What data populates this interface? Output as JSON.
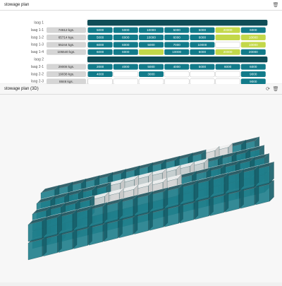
{
  "panel_top": {
    "title": "stowage plan",
    "icon": "trash-icon"
  },
  "panel_bottom": {
    "title": "stowage plan (3D)",
    "icons": [
      "refresh-icon",
      "trash-icon"
    ]
  },
  "chart_data": {
    "type": "table",
    "title": "",
    "x_ticks": [
      "0",
      "5",
      "10"
    ],
    "rows": [
      {
        "label": "laag 1",
        "weight": "",
        "header": true,
        "cells": []
      },
      {
        "label": "laag 1-1",
        "weight": "74612 kgs.",
        "cells": [
          {
            "v": "5000",
            "c": "t"
          },
          {
            "v": "5000",
            "c": "t"
          },
          {
            "v": "10000",
            "c": "t"
          },
          {
            "v": "5000",
            "c": "t"
          },
          {
            "v": "5000",
            "c": "t"
          },
          {
            "v": "20000",
            "c": "y"
          },
          {
            "v": "6000",
            "c": "t"
          }
        ]
      },
      {
        "label": "laag 1-2",
        "weight": "65714 kgs.",
        "cells": [
          {
            "v": "5000",
            "c": "t"
          },
          {
            "v": "6000",
            "c": "t"
          },
          {
            "v": "10000",
            "c": "t"
          },
          {
            "v": "6000",
            "c": "t"
          },
          {
            "v": "6000",
            "c": "t"
          },
          {
            "v": "",
            "c": "y"
          },
          {
            "v": "10000",
            "c": "y"
          }
        ]
      },
      {
        "label": "laag 1-3",
        "weight": "55244 kgs.",
        "cells": [
          {
            "v": "6000",
            "c": "t"
          },
          {
            "v": "6000",
            "c": "t"
          },
          {
            "v": "5000",
            "c": "t"
          },
          {
            "v": "7000",
            "c": "t"
          },
          {
            "v": "10000",
            "c": "t"
          },
          {
            "v": "",
            "c": "w"
          },
          {
            "v": "10000",
            "c": "y"
          }
        ]
      },
      {
        "label": "laag 1-4",
        "weight": "105540 kgs.",
        "cells": [
          {
            "v": "6000",
            "c": "t"
          },
          {
            "v": "6000",
            "c": "t"
          },
          {
            "v": "",
            "c": "y"
          },
          {
            "v": "10000",
            "c": "t"
          },
          {
            "v": "6000",
            "c": "t"
          },
          {
            "v": "20000",
            "c": "y"
          },
          {
            "v": "20000",
            "c": "t"
          }
        ]
      },
      {
        "label": "laag 2",
        "weight": "",
        "header": true,
        "cells": []
      },
      {
        "label": "laag 2-1",
        "weight": "29008 kgs.",
        "cells": [
          {
            "v": "2000",
            "c": "t"
          },
          {
            "v": "4000",
            "c": "t"
          },
          {
            "v": "5000",
            "c": "t"
          },
          {
            "v": "4000",
            "c": "t"
          },
          {
            "v": "5000",
            "c": "t"
          },
          {
            "v": "6000",
            "c": "t"
          },
          {
            "v": "6000",
            "c": "t"
          }
        ]
      },
      {
        "label": "laag 2-2",
        "weight": "19038 kgs.",
        "cells": [
          {
            "v": "4000",
            "c": "t"
          },
          {
            "v": "",
            "c": "w"
          },
          {
            "v": "3000",
            "c": "t"
          },
          {
            "v": "",
            "c": "w"
          },
          {
            "v": "",
            "c": "w"
          },
          {
            "v": "",
            "c": "w"
          },
          {
            "v": "9000",
            "c": "t"
          }
        ]
      },
      {
        "label": "laag 2-3",
        "weight": "8846 kgs.",
        "cells": [
          {
            "v": "",
            "c": "w"
          },
          {
            "v": "",
            "c": "w"
          },
          {
            "v": "",
            "c": "w"
          },
          {
            "v": "",
            "c": "w"
          },
          {
            "v": "",
            "c": "w"
          },
          {
            "v": "",
            "c": "w"
          },
          {
            "v": "9000",
            "c": "t"
          }
        ]
      },
      {
        "label": "laag 2-4",
        "weight": "43468 kgs.",
        "cells": [
          {
            "v": "2000",
            "c": "t"
          },
          {
            "v": "5000",
            "c": "t"
          },
          {
            "v": "5000",
            "c": "t"
          },
          {
            "v": "12000",
            "c": "t"
          },
          {
            "v": "6000",
            "c": "t"
          },
          {
            "v": "6000",
            "c": "t"
          },
          {
            "v": "6000",
            "c": "t"
          }
        ]
      }
    ]
  },
  "colors": {
    "teal": "#127b8a",
    "dark_teal": "#0f4d57",
    "yellow_green": "#c3d84a",
    "gray_label": "#d5d5d5",
    "cube_white": "#e6e6e6"
  }
}
